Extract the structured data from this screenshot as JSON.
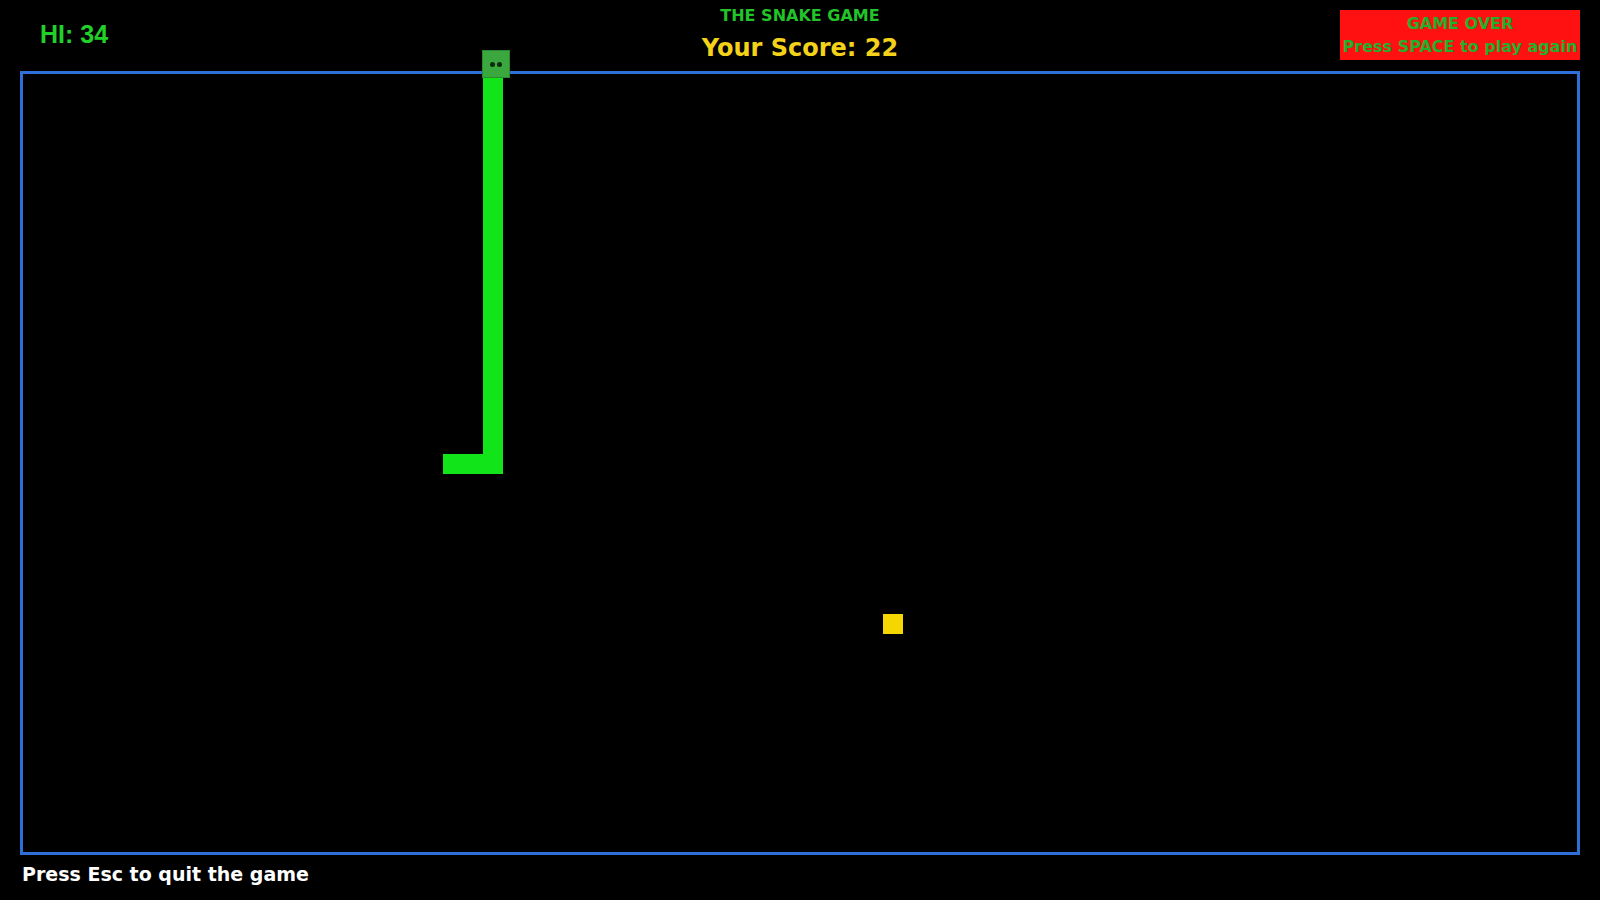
{
  "hud": {
    "high_score_label": "HI: 34",
    "title": "THE SNAKE GAME",
    "score_label": "Your Score: 22"
  },
  "game_over": {
    "title": "GAME OVER",
    "hint": "Press SPACE to play again"
  },
  "board": {
    "cols": 78,
    "rows": 39,
    "snake": {
      "head": {
        "col": 23,
        "row": -1
      },
      "body": [
        {
          "col": 23,
          "row": 0
        },
        {
          "col": 23,
          "row": 1
        },
        {
          "col": 23,
          "row": 2
        },
        {
          "col": 23,
          "row": 3
        },
        {
          "col": 23,
          "row": 4
        },
        {
          "col": 23,
          "row": 5
        },
        {
          "col": 23,
          "row": 6
        },
        {
          "col": 23,
          "row": 7
        },
        {
          "col": 23,
          "row": 8
        },
        {
          "col": 23,
          "row": 9
        },
        {
          "col": 23,
          "row": 10
        },
        {
          "col": 23,
          "row": 11
        },
        {
          "col": 23,
          "row": 12
        },
        {
          "col": 23,
          "row": 13
        },
        {
          "col": 23,
          "row": 14
        },
        {
          "col": 23,
          "row": 15
        },
        {
          "col": 23,
          "row": 16
        },
        {
          "col": 23,
          "row": 17
        },
        {
          "col": 23,
          "row": 18
        },
        {
          "col": 23,
          "row": 19
        },
        {
          "col": 22,
          "row": 19
        },
        {
          "col": 21,
          "row": 19
        }
      ]
    },
    "food": {
      "col": 43,
      "row": 27
    }
  },
  "footer": {
    "hint": "Press Esc to quit the game"
  }
}
